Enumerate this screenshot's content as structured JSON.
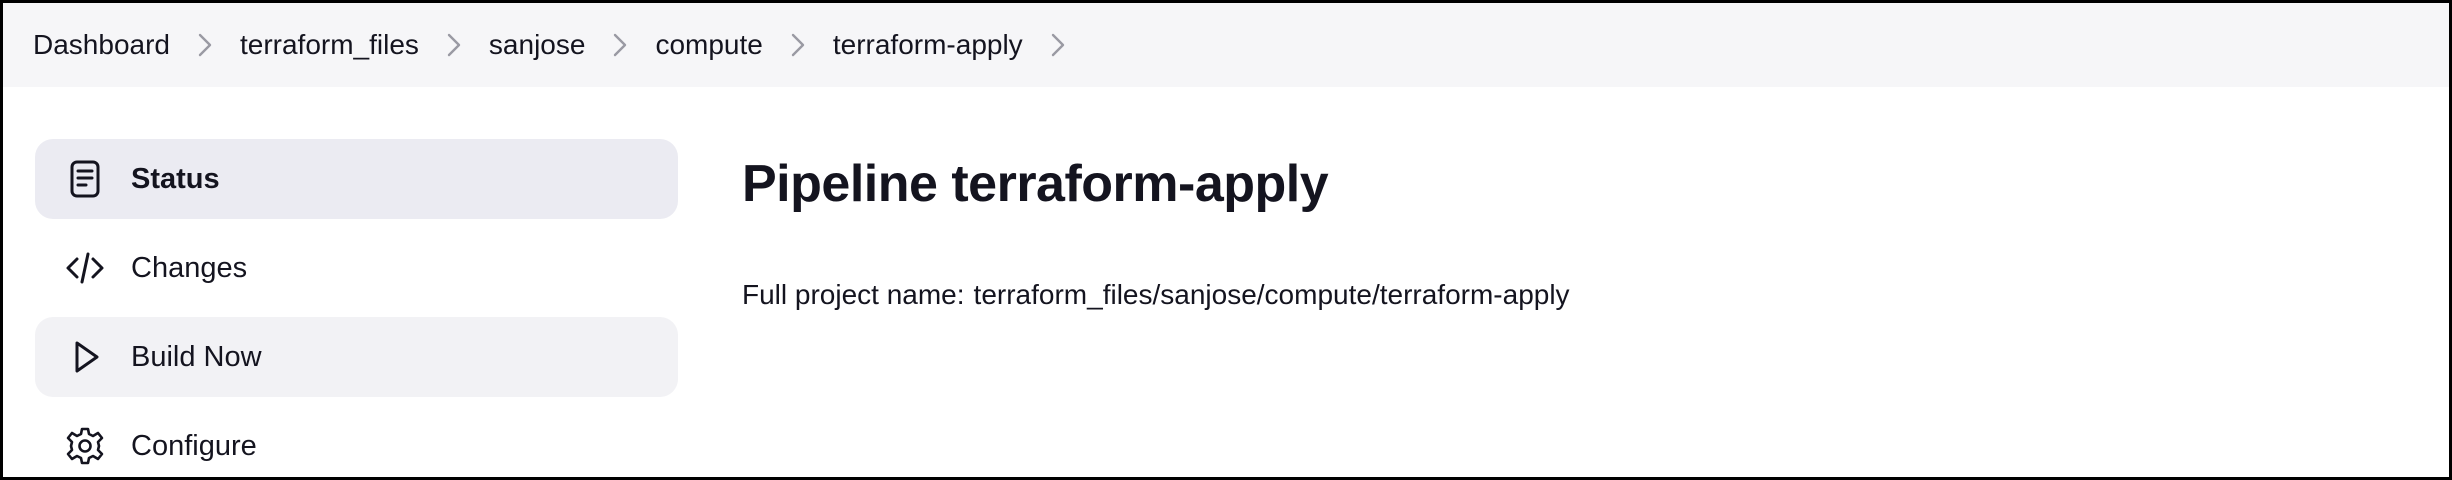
{
  "breadcrumb": [
    {
      "label": "Dashboard"
    },
    {
      "label": "terraform_files"
    },
    {
      "label": "sanjose"
    },
    {
      "label": "compute"
    },
    {
      "label": "terraform-apply"
    }
  ],
  "sidebar": {
    "items": [
      {
        "label": "Status",
        "icon": "status-document-icon",
        "state": "active"
      },
      {
        "label": "Changes",
        "icon": "code-icon",
        "state": "normal"
      },
      {
        "label": "Build Now",
        "icon": "play-icon",
        "state": "hover"
      },
      {
        "label": "Configure",
        "icon": "gear-icon",
        "state": "normal"
      }
    ]
  },
  "main": {
    "title": "Pipeline terraform-apply",
    "full_name_label": "Full project name:",
    "full_name_value": "terraform_files/sanjose/compute/terraform-apply"
  },
  "colors": {
    "breadcrumb_bg": "#f6f6f8",
    "active_item_bg": "#ebebf2",
    "hover_item_bg": "#f2f2f5",
    "text": "#14141f",
    "chevron": "#9a9aa3"
  }
}
